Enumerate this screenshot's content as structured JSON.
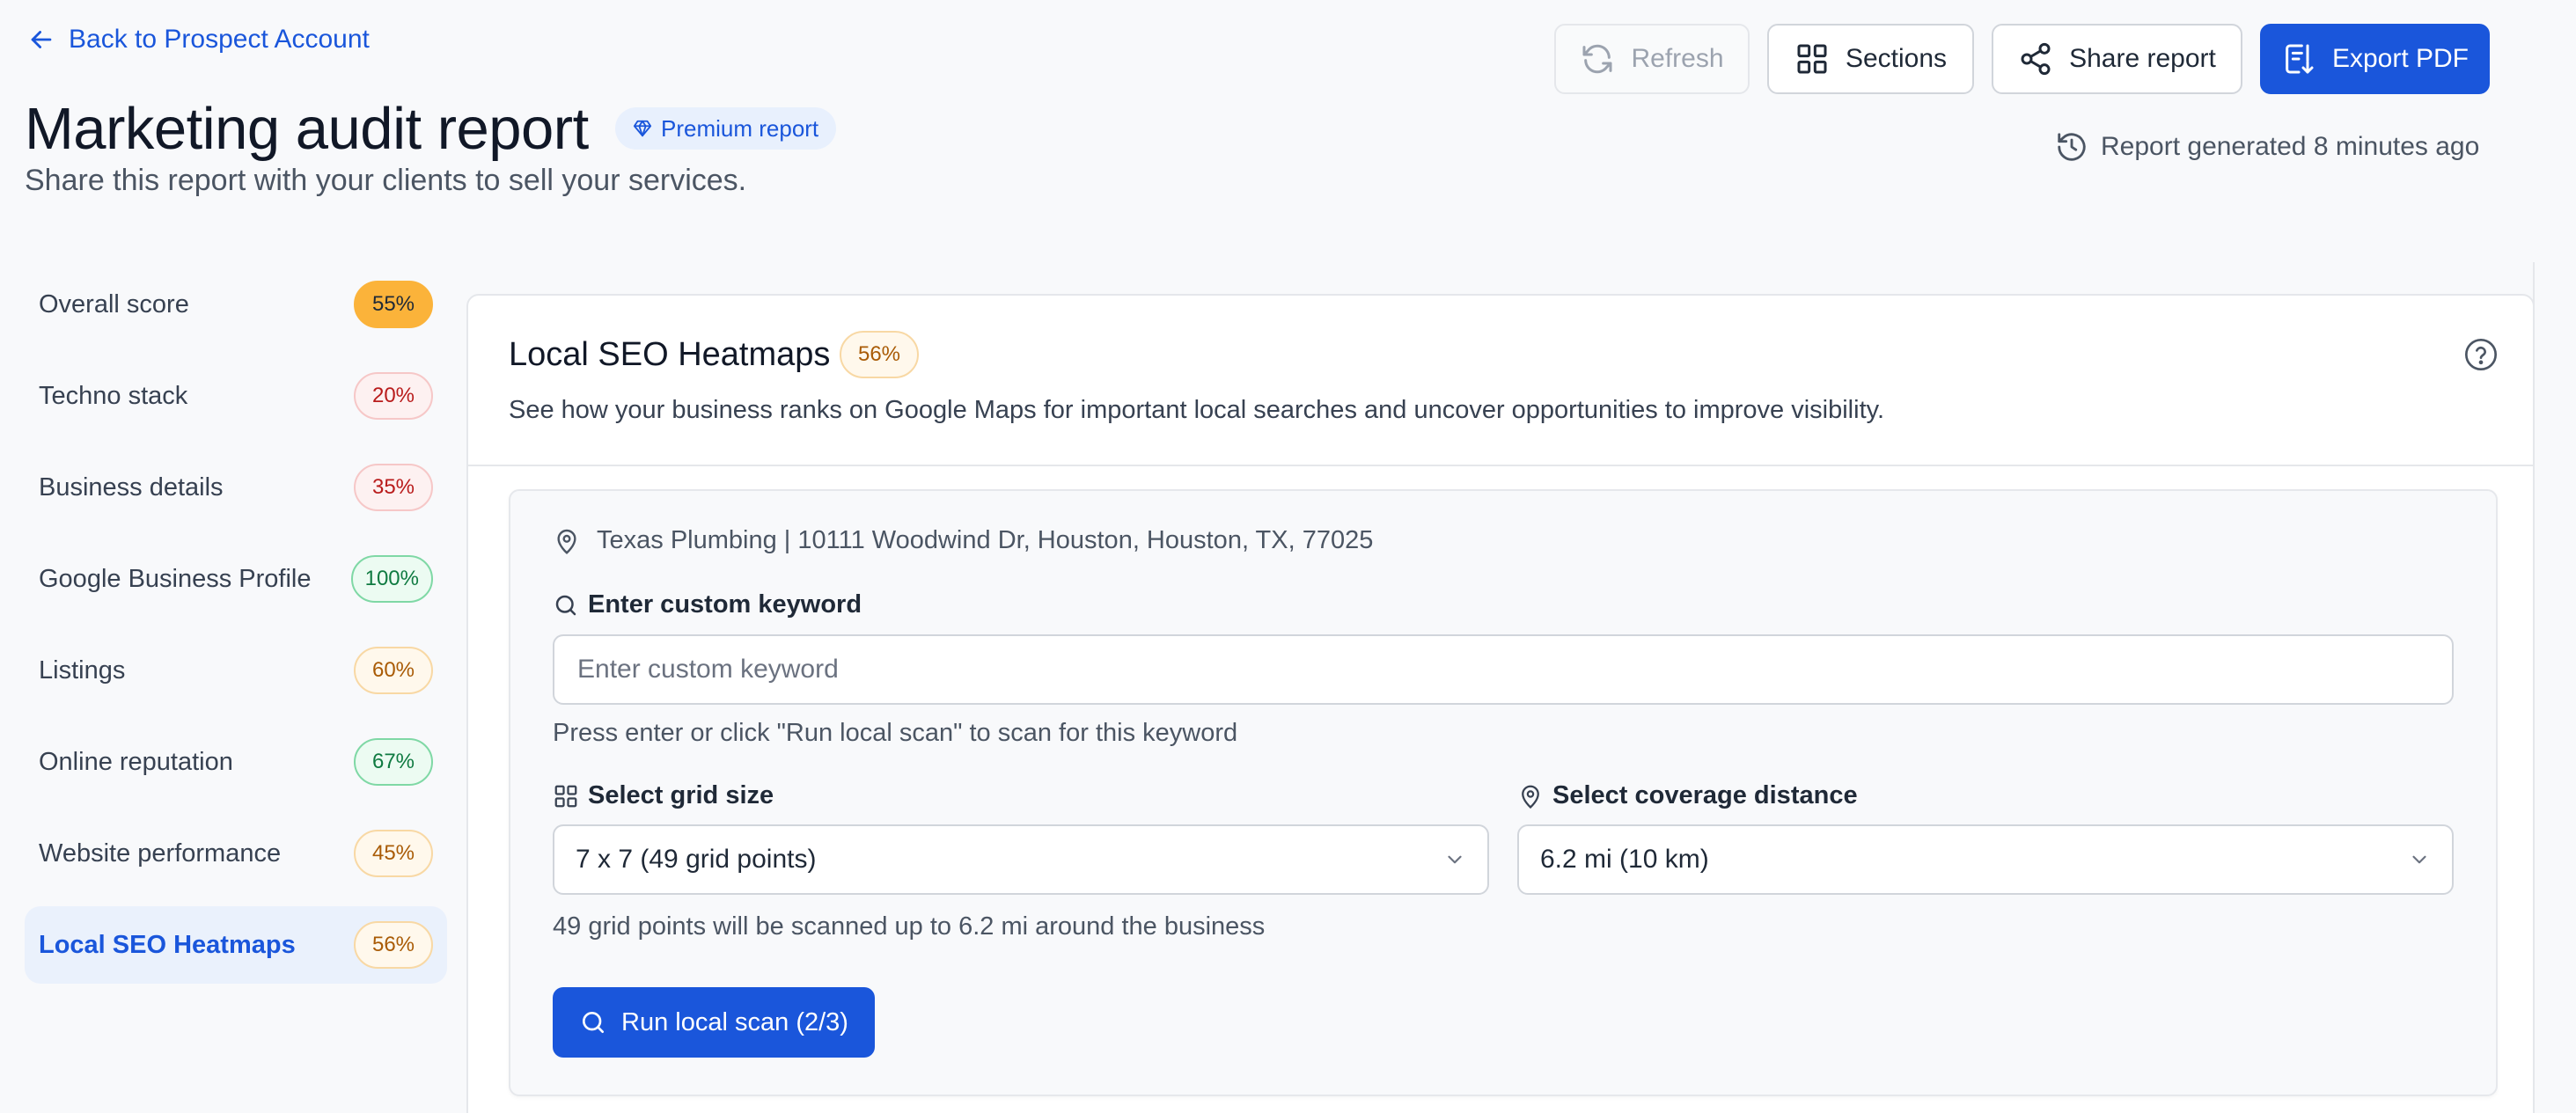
{
  "header": {
    "back_label": "Back to Prospect Account",
    "title": "Marketing audit report",
    "premium_label": "Premium report",
    "subtitle": "Share this report with your clients to sell your services.",
    "generated_text": "Report generated 8 minutes ago"
  },
  "toolbar": {
    "refresh_label": "Refresh",
    "sections_label": "Sections",
    "share_label": "Share report",
    "export_label": "Export PDF"
  },
  "sidebar": {
    "items": [
      {
        "label": "Overall score",
        "score": "55%"
      },
      {
        "label": "Techno stack",
        "score": "20%"
      },
      {
        "label": "Business details",
        "score": "35%"
      },
      {
        "label": "Google Business Profile",
        "score": "100%"
      },
      {
        "label": "Listings",
        "score": "60%"
      },
      {
        "label": "Online reputation",
        "score": "67%"
      },
      {
        "label": "Website performance",
        "score": "45%"
      },
      {
        "label": "Local SEO Heatmaps",
        "score": "56%"
      }
    ]
  },
  "section": {
    "title": "Local SEO Heatmaps",
    "score": "56%",
    "description": "See how your business ranks on Google Maps for important local searches and uncover opportunities to improve visibility.",
    "address": "Texas Plumbing | 10111 Woodwind Dr, Houston, Houston, TX, 77025",
    "keyword_label": "Enter custom keyword",
    "keyword_placeholder": "Enter custom keyword",
    "keyword_value": "",
    "keyword_hint": "Press enter or click \"Run local scan\" to scan for this keyword",
    "grid_label": "Select grid size",
    "grid_value": "7 x 7 (49 grid points)",
    "distance_label": "Select coverage distance",
    "distance_value": "6.2 mi (10 km)",
    "grid_hint": "49 grid points will be scanned up to 6.2 mi around the business",
    "run_label": "Run local scan (2/3)"
  },
  "colors": {
    "accent": "#1a56db",
    "active_bg": "#eaf1fc",
    "score_amber": "#fbb33a",
    "score_red": "#b91c1c",
    "score_orange": "#a95b06",
    "score_green": "#0f7a41"
  }
}
